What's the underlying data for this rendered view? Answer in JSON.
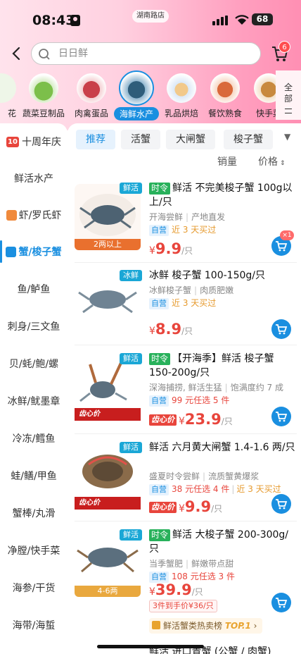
{
  "status": {
    "time": "08:43",
    "location": "湖南路店",
    "battery": "68"
  },
  "search": {
    "placeholder": "日日鲜"
  },
  "cart": {
    "badge": "6"
  },
  "categories": [
    {
      "label": "花"
    },
    {
      "label": "蔬菜豆制品"
    },
    {
      "label": "肉禽蛋品"
    },
    {
      "label": "海鲜水产"
    },
    {
      "label": "乳品烘焙"
    },
    {
      "label": "餐饮熟食"
    },
    {
      "label": "快手菜"
    }
  ],
  "all_label": "全部",
  "sidebar": [
    {
      "label": "十周年庆",
      "prefix": "10"
    },
    {
      "label": "鲜活水产"
    },
    {
      "label": "虾/罗氏虾"
    },
    {
      "label": "蟹/梭子蟹"
    },
    {
      "label": "鱼/鲈鱼"
    },
    {
      "label": "刺身/三文鱼"
    },
    {
      "label": "贝/蚝/鲍/螺"
    },
    {
      "label": "冰鲜/鱿墨章"
    },
    {
      "label": "冷冻/鳕鱼"
    },
    {
      "label": "蛙/鳝/甲鱼"
    },
    {
      "label": "蟹棒/丸滑"
    },
    {
      "label": "净膛/快手菜"
    },
    {
      "label": "海参/干货"
    },
    {
      "label": "海带/海蜇"
    }
  ],
  "tabs": [
    {
      "label": "推荐"
    },
    {
      "label": "活蟹"
    },
    {
      "label": "大闸蟹"
    },
    {
      "label": "梭子蟹"
    }
  ],
  "sort": {
    "sales": "销量",
    "price": "价格"
  },
  "products": [
    {
      "tag": "鲜活",
      "img_label": "2两以上",
      "seasonal": "时令",
      "title": "鲜活 不完美梭子蟹 100g以上/只",
      "desc1": "开海尝鲜",
      "desc2": "产地直发",
      "self": "自营",
      "meta": "近 3 天买过",
      "price": "9.9",
      "unit": "/只",
      "cart_count": "×1"
    },
    {
      "tag": "冰鲜",
      "title": "冰鲜 梭子蟹 100-150g/只",
      "desc1": "冰鲜梭子蟹",
      "desc2": "肉质肥嫩",
      "self": "自营",
      "meta": "近 3 天买过",
      "price": "8.9",
      "unit": "/只"
    },
    {
      "tag": "鲜活",
      "img_band": "齿心价",
      "seasonal": "时令",
      "title": "【开海季】鲜活 梭子蟹 150-200g/只",
      "desc1": "深海捕捞, 鲜活生猛",
      "desc2": "饱满度约 7 成",
      "self": "自营",
      "meta": "99 元任选 5 件",
      "heart": "齿心价",
      "price": "23.9",
      "unit": "/只"
    },
    {
      "tag": "鲜活",
      "img_band": "齿心价",
      "title": "鲜活 六月黄大闸蟹 1.4-1.6 两/只",
      "desc1": "盛夏时令尝鲜",
      "desc2": "流质蟹黄爆浆",
      "self": "自营",
      "meta": "38 元任选 4 件",
      "meta2": "近 3 天买过",
      "heart": "齿心价",
      "price": "9.9",
      "unit": "/只"
    },
    {
      "tag": "鲜活",
      "img_label": "4-6两",
      "seasonal": "时令",
      "title": "鲜活 大梭子蟹 200-300g/只",
      "desc1": "当季蟹肥",
      "desc2": "鲜嫩带点甜",
      "self": "自营",
      "meta": "108 元任选 3 件",
      "price": "39.9",
      "unit": "/只",
      "promo": "3件到手价¥36/只",
      "rank": "鲜活蟹类热卖榜",
      "rank_top": "TOP.1"
    },
    {
      "title": "鲜活 进口青蟹 (公蟹 / 肉蟹)"
    }
  ]
}
